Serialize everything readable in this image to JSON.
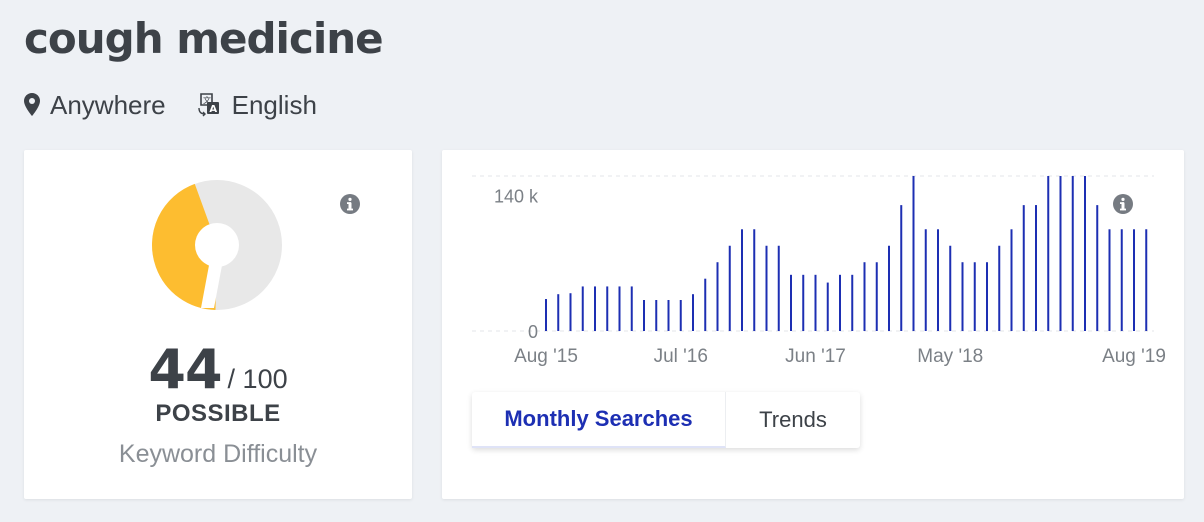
{
  "keyword": "cough medicine",
  "location": {
    "label": "Anywhere",
    "icon": "location-pin-icon"
  },
  "language": {
    "label": "English",
    "icon": "translate-icon"
  },
  "difficulty": {
    "score": "44",
    "max": "/ 100",
    "rating": "POSSIBLE",
    "caption": "Keyword Difficulty",
    "fraction": 0.44,
    "colors": {
      "fill": "#fdbd30",
      "track": "#e8e8e8"
    }
  },
  "volume_tabs": {
    "active": "Monthly Searches",
    "other": "Trends"
  },
  "colors": {
    "bar": "#1d2fb3",
    "tab_active": "#1d2fb3"
  },
  "chart_data": {
    "type": "bar",
    "y_ticks": [
      "140 k",
      "0"
    ],
    "ylim": [
      0,
      160
    ],
    "y_tick_values": [
      140,
      0
    ],
    "x_tick_labels": [
      {
        "label": "Aug '15",
        "index": 0
      },
      {
        "label": "Jul '16",
        "index": 11
      },
      {
        "label": "Jun '17",
        "index": 22
      },
      {
        "label": "May '18",
        "index": 33
      },
      {
        "label": "Aug '19",
        "index": 48
      }
    ],
    "grid": true,
    "values": [
      33,
      38,
      39,
      46,
      46,
      46,
      46,
      46,
      32,
      32,
      32,
      32,
      38,
      54,
      71,
      88,
      105,
      105,
      88,
      88,
      58,
      58,
      58,
      50,
      58,
      58,
      71,
      71,
      88,
      130,
      160,
      105,
      105,
      88,
      71,
      71,
      71,
      88,
      105,
      130,
      130,
      160,
      160,
      160,
      160,
      130,
      105,
      105,
      105,
      105
    ]
  }
}
